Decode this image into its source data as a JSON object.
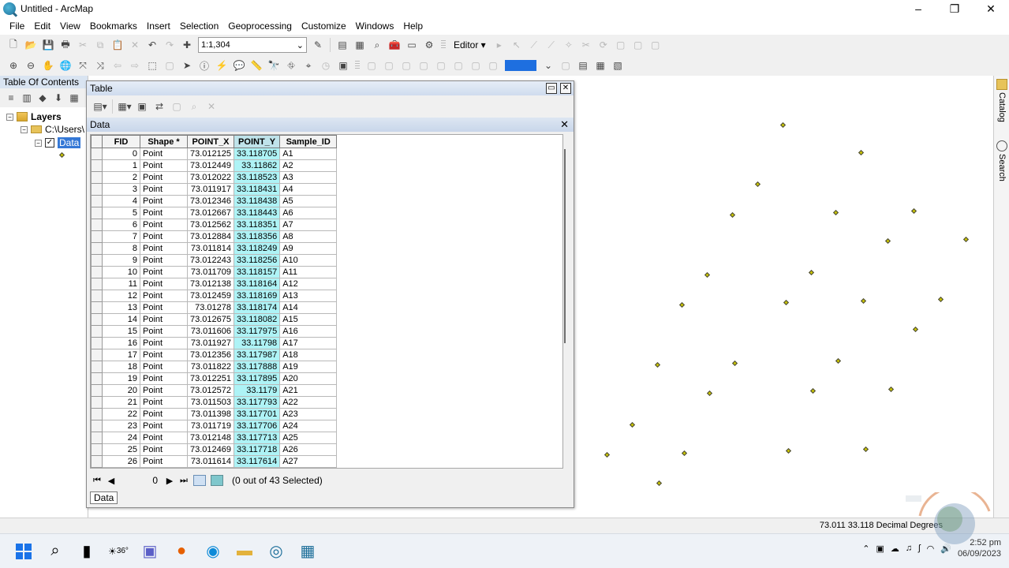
{
  "window": {
    "title": "Untitled - ArcMap",
    "controls": [
      "–",
      "❐",
      "✕"
    ]
  },
  "menu": [
    "File",
    "Edit",
    "View",
    "Bookmarks",
    "Insert",
    "Selection",
    "Geoprocessing",
    "Customize",
    "Windows",
    "Help"
  ],
  "toolbar": {
    "scale": "1:1,304",
    "editor_label": "Editor ▾"
  },
  "toc": {
    "title": "Table Of Contents",
    "layers_label": "Layers",
    "path_label": "C:\\Users\\",
    "layer_label": "Data"
  },
  "table_window": {
    "title": "Table",
    "tab_title": "Data",
    "columns": [
      "FID",
      "Shape *",
      "POINT_X",
      "POINT_Y",
      "Sample_ID"
    ],
    "rows": [
      [
        "0",
        "Point",
        "73.012125",
        "33.118705",
        "A1"
      ],
      [
        "1",
        "Point",
        "73.012449",
        "33.11862",
        "A2"
      ],
      [
        "2",
        "Point",
        "73.012022",
        "33.118523",
        "A3"
      ],
      [
        "3",
        "Point",
        "73.011917",
        "33.118431",
        "A4"
      ],
      [
        "4",
        "Point",
        "73.012346",
        "33.118438",
        "A5"
      ],
      [
        "5",
        "Point",
        "73.012667",
        "33.118443",
        "A6"
      ],
      [
        "6",
        "Point",
        "73.012562",
        "33.118351",
        "A7"
      ],
      [
        "7",
        "Point",
        "73.012884",
        "33.118356",
        "A8"
      ],
      [
        "8",
        "Point",
        "73.011814",
        "33.118249",
        "A9"
      ],
      [
        "9",
        "Point",
        "73.012243",
        "33.118256",
        "A10"
      ],
      [
        "10",
        "Point",
        "73.011709",
        "33.118157",
        "A11"
      ],
      [
        "11",
        "Point",
        "73.012138",
        "33.118164",
        "A12"
      ],
      [
        "12",
        "Point",
        "73.012459",
        "33.118169",
        "A13"
      ],
      [
        "13",
        "Point",
        "73.01278",
        "33.118174",
        "A14"
      ],
      [
        "14",
        "Point",
        "73.012675",
        "33.118082",
        "A15"
      ],
      [
        "15",
        "Point",
        "73.011606",
        "33.117975",
        "A16"
      ],
      [
        "16",
        "Point",
        "73.011927",
        "33.11798",
        "A17"
      ],
      [
        "17",
        "Point",
        "73.012356",
        "33.117987",
        "A18"
      ],
      [
        "18",
        "Point",
        "73.011822",
        "33.117888",
        "A19"
      ],
      [
        "19",
        "Point",
        "73.012251",
        "33.117895",
        "A20"
      ],
      [
        "20",
        "Point",
        "73.012572",
        "33.1179",
        "A21"
      ],
      [
        "21",
        "Point",
        "73.011503",
        "33.117793",
        "A22"
      ],
      [
        "22",
        "Point",
        "73.011398",
        "33.117701",
        "A23"
      ],
      [
        "23",
        "Point",
        "73.011719",
        "33.117706",
        "A24"
      ],
      [
        "24",
        "Point",
        "73.012148",
        "33.117713",
        "A25"
      ],
      [
        "25",
        "Point",
        "73.012469",
        "33.117718",
        "A26"
      ],
      [
        "26",
        "Point",
        "73.011614",
        "33.117614",
        "A27"
      ]
    ],
    "record_number": "0",
    "selection_status": "(0 out of 43 Selected)",
    "bottom_tab": "Data"
  },
  "side_panel": {
    "catalog": "Catalog",
    "search": "Search"
  },
  "status_bar": {
    "coordinates": "73.011  33.118 Decimal Degrees"
  },
  "taskbar": {
    "weather_temp": "36°",
    "time": "2:52 pm",
    "date": "06/09/2023"
  },
  "colors": {
    "point_fill": "#c9c400",
    "selected_layer": "#3478d6",
    "selected_column": "#aef3f6"
  }
}
